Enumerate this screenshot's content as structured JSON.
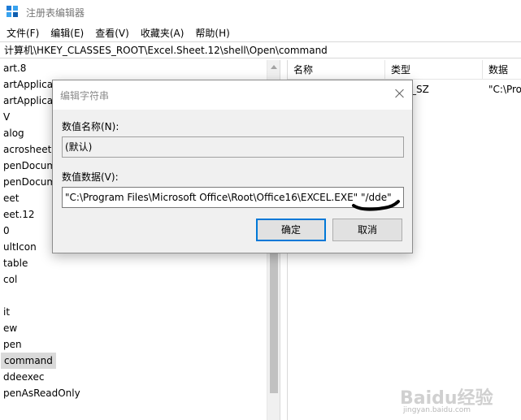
{
  "window": {
    "title": "注册表编辑器"
  },
  "menu": {
    "items": [
      "文件(F)",
      "编辑(E)",
      "查看(V)",
      "收藏夹(A)",
      "帮助(H)"
    ]
  },
  "address": {
    "path": "计算机\\HKEY_CLASSES_ROOT\\Excel.Sheet.12\\shell\\Open\\command"
  },
  "tree": {
    "items": [
      "art.8",
      "artApplicat",
      "artApplicat",
      "V",
      "alog",
      "acrosheet",
      "penDocume",
      "penDocume",
      "eet",
      "eet.12",
      "0",
      "ultIcon",
      "table",
      "col",
      "",
      "it",
      "ew",
      "pen",
      "command",
      "ddeexec",
      "penAsReadOnly"
    ],
    "selected_index": 18
  },
  "list": {
    "headers": {
      "name": "名称",
      "type": "类型",
      "data": "数据"
    },
    "rows": [
      {
        "type": "_SZ",
        "data": "\"C:\\Pro"
      }
    ]
  },
  "dialog": {
    "title": "编辑字符串",
    "name_label": "数值名称(N):",
    "name_value": "(默认)",
    "data_label": "数值数据(V):",
    "data_value": "\"C:\\Program Files\\Microsoft Office\\Root\\Office16\\EXCEL.EXE\" \"/dde\"",
    "ok_label": "确定",
    "cancel_label": "取消"
  },
  "watermark": {
    "brand": "Baidu经验",
    "url": "jingyan.baidu.com"
  }
}
